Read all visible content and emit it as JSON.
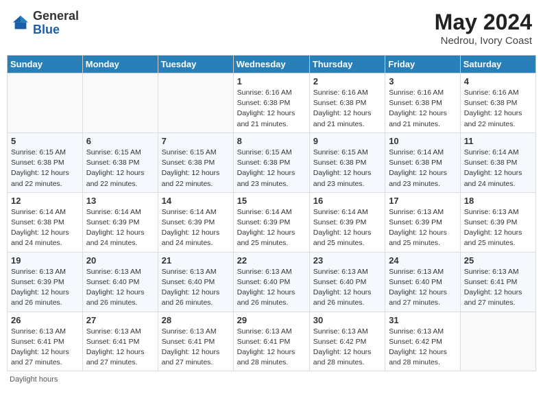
{
  "header": {
    "logo_general": "General",
    "logo_blue": "Blue",
    "title": "May 2024",
    "location": "Nedrou, Ivory Coast"
  },
  "days_of_week": [
    "Sunday",
    "Monday",
    "Tuesday",
    "Wednesday",
    "Thursday",
    "Friday",
    "Saturday"
  ],
  "weeks": [
    [
      {
        "day": "",
        "info": ""
      },
      {
        "day": "",
        "info": ""
      },
      {
        "day": "",
        "info": ""
      },
      {
        "day": "1",
        "info": "Sunrise: 6:16 AM\nSunset: 6:38 PM\nDaylight: 12 hours and 21 minutes."
      },
      {
        "day": "2",
        "info": "Sunrise: 6:16 AM\nSunset: 6:38 PM\nDaylight: 12 hours and 21 minutes."
      },
      {
        "day": "3",
        "info": "Sunrise: 6:16 AM\nSunset: 6:38 PM\nDaylight: 12 hours and 21 minutes."
      },
      {
        "day": "4",
        "info": "Sunrise: 6:16 AM\nSunset: 6:38 PM\nDaylight: 12 hours and 22 minutes."
      }
    ],
    [
      {
        "day": "5",
        "info": "Sunrise: 6:15 AM\nSunset: 6:38 PM\nDaylight: 12 hours and 22 minutes."
      },
      {
        "day": "6",
        "info": "Sunrise: 6:15 AM\nSunset: 6:38 PM\nDaylight: 12 hours and 22 minutes."
      },
      {
        "day": "7",
        "info": "Sunrise: 6:15 AM\nSunset: 6:38 PM\nDaylight: 12 hours and 22 minutes."
      },
      {
        "day": "8",
        "info": "Sunrise: 6:15 AM\nSunset: 6:38 PM\nDaylight: 12 hours and 23 minutes."
      },
      {
        "day": "9",
        "info": "Sunrise: 6:15 AM\nSunset: 6:38 PM\nDaylight: 12 hours and 23 minutes."
      },
      {
        "day": "10",
        "info": "Sunrise: 6:14 AM\nSunset: 6:38 PM\nDaylight: 12 hours and 23 minutes."
      },
      {
        "day": "11",
        "info": "Sunrise: 6:14 AM\nSunset: 6:38 PM\nDaylight: 12 hours and 24 minutes."
      }
    ],
    [
      {
        "day": "12",
        "info": "Sunrise: 6:14 AM\nSunset: 6:38 PM\nDaylight: 12 hours and 24 minutes."
      },
      {
        "day": "13",
        "info": "Sunrise: 6:14 AM\nSunset: 6:39 PM\nDaylight: 12 hours and 24 minutes."
      },
      {
        "day": "14",
        "info": "Sunrise: 6:14 AM\nSunset: 6:39 PM\nDaylight: 12 hours and 24 minutes."
      },
      {
        "day": "15",
        "info": "Sunrise: 6:14 AM\nSunset: 6:39 PM\nDaylight: 12 hours and 25 minutes."
      },
      {
        "day": "16",
        "info": "Sunrise: 6:14 AM\nSunset: 6:39 PM\nDaylight: 12 hours and 25 minutes."
      },
      {
        "day": "17",
        "info": "Sunrise: 6:13 AM\nSunset: 6:39 PM\nDaylight: 12 hours and 25 minutes."
      },
      {
        "day": "18",
        "info": "Sunrise: 6:13 AM\nSunset: 6:39 PM\nDaylight: 12 hours and 25 minutes."
      }
    ],
    [
      {
        "day": "19",
        "info": "Sunrise: 6:13 AM\nSunset: 6:39 PM\nDaylight: 12 hours and 26 minutes."
      },
      {
        "day": "20",
        "info": "Sunrise: 6:13 AM\nSunset: 6:40 PM\nDaylight: 12 hours and 26 minutes."
      },
      {
        "day": "21",
        "info": "Sunrise: 6:13 AM\nSunset: 6:40 PM\nDaylight: 12 hours and 26 minutes."
      },
      {
        "day": "22",
        "info": "Sunrise: 6:13 AM\nSunset: 6:40 PM\nDaylight: 12 hours and 26 minutes."
      },
      {
        "day": "23",
        "info": "Sunrise: 6:13 AM\nSunset: 6:40 PM\nDaylight: 12 hours and 26 minutes."
      },
      {
        "day": "24",
        "info": "Sunrise: 6:13 AM\nSunset: 6:40 PM\nDaylight: 12 hours and 27 minutes."
      },
      {
        "day": "25",
        "info": "Sunrise: 6:13 AM\nSunset: 6:41 PM\nDaylight: 12 hours and 27 minutes."
      }
    ],
    [
      {
        "day": "26",
        "info": "Sunrise: 6:13 AM\nSunset: 6:41 PM\nDaylight: 12 hours and 27 minutes."
      },
      {
        "day": "27",
        "info": "Sunrise: 6:13 AM\nSunset: 6:41 PM\nDaylight: 12 hours and 27 minutes."
      },
      {
        "day": "28",
        "info": "Sunrise: 6:13 AM\nSunset: 6:41 PM\nDaylight: 12 hours and 27 minutes."
      },
      {
        "day": "29",
        "info": "Sunrise: 6:13 AM\nSunset: 6:41 PM\nDaylight: 12 hours and 28 minutes."
      },
      {
        "day": "30",
        "info": "Sunrise: 6:13 AM\nSunset: 6:42 PM\nDaylight: 12 hours and 28 minutes."
      },
      {
        "day": "31",
        "info": "Sunrise: 6:13 AM\nSunset: 6:42 PM\nDaylight: 12 hours and 28 minutes."
      },
      {
        "day": "",
        "info": ""
      }
    ]
  ],
  "footer": "Daylight hours"
}
